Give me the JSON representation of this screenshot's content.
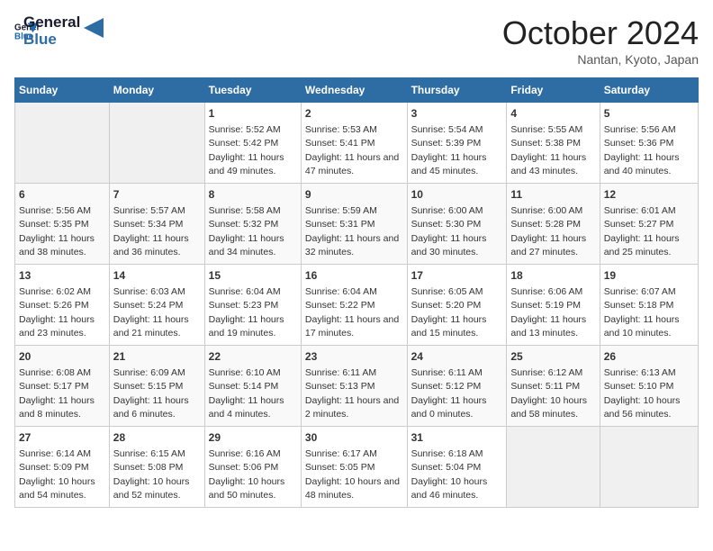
{
  "logo": {
    "line1": "General",
    "line2": "Blue"
  },
  "title": "October 2024",
  "location": "Nantan, Kyoto, Japan",
  "days_of_week": [
    "Sunday",
    "Monday",
    "Tuesday",
    "Wednesday",
    "Thursday",
    "Friday",
    "Saturday"
  ],
  "weeks": [
    [
      {
        "day": "",
        "sunrise": "",
        "sunset": "",
        "daylight": ""
      },
      {
        "day": "",
        "sunrise": "",
        "sunset": "",
        "daylight": ""
      },
      {
        "day": "1",
        "sunrise": "Sunrise: 5:52 AM",
        "sunset": "Sunset: 5:42 PM",
        "daylight": "Daylight: 11 hours and 49 minutes."
      },
      {
        "day": "2",
        "sunrise": "Sunrise: 5:53 AM",
        "sunset": "Sunset: 5:41 PM",
        "daylight": "Daylight: 11 hours and 47 minutes."
      },
      {
        "day": "3",
        "sunrise": "Sunrise: 5:54 AM",
        "sunset": "Sunset: 5:39 PM",
        "daylight": "Daylight: 11 hours and 45 minutes."
      },
      {
        "day": "4",
        "sunrise": "Sunrise: 5:55 AM",
        "sunset": "Sunset: 5:38 PM",
        "daylight": "Daylight: 11 hours and 43 minutes."
      },
      {
        "day": "5",
        "sunrise": "Sunrise: 5:56 AM",
        "sunset": "Sunset: 5:36 PM",
        "daylight": "Daylight: 11 hours and 40 minutes."
      }
    ],
    [
      {
        "day": "6",
        "sunrise": "Sunrise: 5:56 AM",
        "sunset": "Sunset: 5:35 PM",
        "daylight": "Daylight: 11 hours and 38 minutes."
      },
      {
        "day": "7",
        "sunrise": "Sunrise: 5:57 AM",
        "sunset": "Sunset: 5:34 PM",
        "daylight": "Daylight: 11 hours and 36 minutes."
      },
      {
        "day": "8",
        "sunrise": "Sunrise: 5:58 AM",
        "sunset": "Sunset: 5:32 PM",
        "daylight": "Daylight: 11 hours and 34 minutes."
      },
      {
        "day": "9",
        "sunrise": "Sunrise: 5:59 AM",
        "sunset": "Sunset: 5:31 PM",
        "daylight": "Daylight: 11 hours and 32 minutes."
      },
      {
        "day": "10",
        "sunrise": "Sunrise: 6:00 AM",
        "sunset": "Sunset: 5:30 PM",
        "daylight": "Daylight: 11 hours and 30 minutes."
      },
      {
        "day": "11",
        "sunrise": "Sunrise: 6:00 AM",
        "sunset": "Sunset: 5:28 PM",
        "daylight": "Daylight: 11 hours and 27 minutes."
      },
      {
        "day": "12",
        "sunrise": "Sunrise: 6:01 AM",
        "sunset": "Sunset: 5:27 PM",
        "daylight": "Daylight: 11 hours and 25 minutes."
      }
    ],
    [
      {
        "day": "13",
        "sunrise": "Sunrise: 6:02 AM",
        "sunset": "Sunset: 5:26 PM",
        "daylight": "Daylight: 11 hours and 23 minutes."
      },
      {
        "day": "14",
        "sunrise": "Sunrise: 6:03 AM",
        "sunset": "Sunset: 5:24 PM",
        "daylight": "Daylight: 11 hours and 21 minutes."
      },
      {
        "day": "15",
        "sunrise": "Sunrise: 6:04 AM",
        "sunset": "Sunset: 5:23 PM",
        "daylight": "Daylight: 11 hours and 19 minutes."
      },
      {
        "day": "16",
        "sunrise": "Sunrise: 6:04 AM",
        "sunset": "Sunset: 5:22 PM",
        "daylight": "Daylight: 11 hours and 17 minutes."
      },
      {
        "day": "17",
        "sunrise": "Sunrise: 6:05 AM",
        "sunset": "Sunset: 5:20 PM",
        "daylight": "Daylight: 11 hours and 15 minutes."
      },
      {
        "day": "18",
        "sunrise": "Sunrise: 6:06 AM",
        "sunset": "Sunset: 5:19 PM",
        "daylight": "Daylight: 11 hours and 13 minutes."
      },
      {
        "day": "19",
        "sunrise": "Sunrise: 6:07 AM",
        "sunset": "Sunset: 5:18 PM",
        "daylight": "Daylight: 11 hours and 10 minutes."
      }
    ],
    [
      {
        "day": "20",
        "sunrise": "Sunrise: 6:08 AM",
        "sunset": "Sunset: 5:17 PM",
        "daylight": "Daylight: 11 hours and 8 minutes."
      },
      {
        "day": "21",
        "sunrise": "Sunrise: 6:09 AM",
        "sunset": "Sunset: 5:15 PM",
        "daylight": "Daylight: 11 hours and 6 minutes."
      },
      {
        "day": "22",
        "sunrise": "Sunrise: 6:10 AM",
        "sunset": "Sunset: 5:14 PM",
        "daylight": "Daylight: 11 hours and 4 minutes."
      },
      {
        "day": "23",
        "sunrise": "Sunrise: 6:11 AM",
        "sunset": "Sunset: 5:13 PM",
        "daylight": "Daylight: 11 hours and 2 minutes."
      },
      {
        "day": "24",
        "sunrise": "Sunrise: 6:11 AM",
        "sunset": "Sunset: 5:12 PM",
        "daylight": "Daylight: 11 hours and 0 minutes."
      },
      {
        "day": "25",
        "sunrise": "Sunrise: 6:12 AM",
        "sunset": "Sunset: 5:11 PM",
        "daylight": "Daylight: 10 hours and 58 minutes."
      },
      {
        "day": "26",
        "sunrise": "Sunrise: 6:13 AM",
        "sunset": "Sunset: 5:10 PM",
        "daylight": "Daylight: 10 hours and 56 minutes."
      }
    ],
    [
      {
        "day": "27",
        "sunrise": "Sunrise: 6:14 AM",
        "sunset": "Sunset: 5:09 PM",
        "daylight": "Daylight: 10 hours and 54 minutes."
      },
      {
        "day": "28",
        "sunrise": "Sunrise: 6:15 AM",
        "sunset": "Sunset: 5:08 PM",
        "daylight": "Daylight: 10 hours and 52 minutes."
      },
      {
        "day": "29",
        "sunrise": "Sunrise: 6:16 AM",
        "sunset": "Sunset: 5:06 PM",
        "daylight": "Daylight: 10 hours and 50 minutes."
      },
      {
        "day": "30",
        "sunrise": "Sunrise: 6:17 AM",
        "sunset": "Sunset: 5:05 PM",
        "daylight": "Daylight: 10 hours and 48 minutes."
      },
      {
        "day": "31",
        "sunrise": "Sunrise: 6:18 AM",
        "sunset": "Sunset: 5:04 PM",
        "daylight": "Daylight: 10 hours and 46 minutes."
      },
      {
        "day": "",
        "sunrise": "",
        "sunset": "",
        "daylight": ""
      },
      {
        "day": "",
        "sunrise": "",
        "sunset": "",
        "daylight": ""
      }
    ]
  ]
}
